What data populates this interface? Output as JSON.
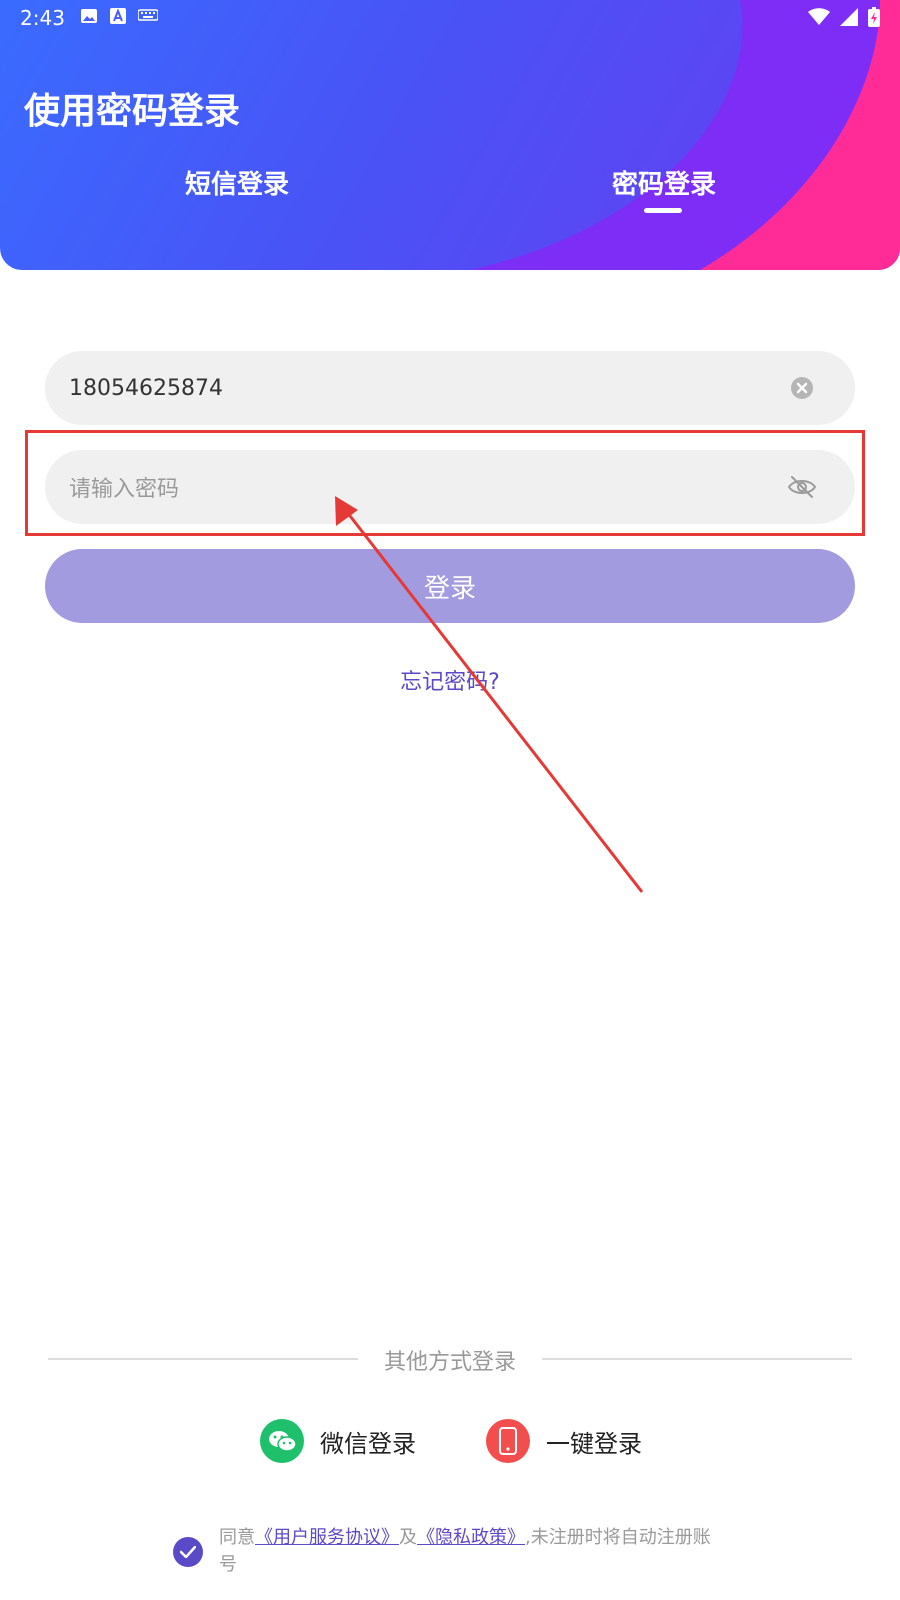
{
  "status_bar": {
    "time": "2:43"
  },
  "header": {
    "title": "使用密码登录",
    "tabs": [
      {
        "label": "短信登录",
        "active": false
      },
      {
        "label": "密码登录",
        "active": true
      }
    ]
  },
  "form": {
    "phone_value": "18054625874",
    "password_placeholder": "请输入密码",
    "login_label": "登录",
    "forgot_label": "忘记密码?"
  },
  "other_login": {
    "divider_label": "其他方式登录",
    "wechat_label": "微信登录",
    "onekey_label": "一键登录"
  },
  "agreement": {
    "prefix": "同意",
    "user_agreement": "《用户服务协议》",
    "and": "及",
    "privacy_policy": "《隐私政策》",
    "suffix": ",未注册时将自动注册账号"
  },
  "colors": {
    "primary": "#5b4ac7",
    "button_disabled": "#a39be0",
    "wechat": "#1ec06b",
    "onekey": "#f24e4e",
    "annotation": "#e53935"
  }
}
